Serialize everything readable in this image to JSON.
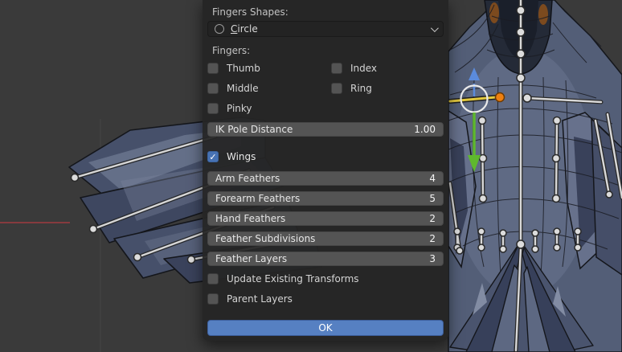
{
  "viewport": {
    "description": "Blender 3D viewport showing a rigged bird model with wing feathers and armature bones",
    "bg_color": "#3a3a3a",
    "axis_x_color": "#a03b40",
    "gizmo": {
      "circle_color": "#e8e8e8",
      "arrow_up_color": "#5b8bdc",
      "arrow_down_color": "#5fb82e",
      "selected_bone_color": "#e3c93f",
      "bone_tip_color": "#ee8011"
    }
  },
  "glyphs": {
    "check": "✓"
  },
  "colors": {
    "checkbox_checked": "#4772b3",
    "ok_button": "#5680c2",
    "field_bg": "#545454",
    "panel_bg": "#252525"
  },
  "panel": {
    "shape_section_label": "Fingers Shapes:",
    "shape_dropdown": {
      "value": "Circle",
      "icon": "circle-outline-icon"
    },
    "fingers_section_label": "Fingers:",
    "fingers": [
      {
        "label": "Thumb",
        "checked": false
      },
      {
        "label": "Index",
        "checked": false
      },
      {
        "label": "Middle",
        "checked": false
      },
      {
        "label": "Ring",
        "checked": false
      },
      {
        "label": "Pinky",
        "checked": false
      }
    ],
    "ik_pole_distance": {
      "label": "IK Pole Distance",
      "value": "1.00"
    },
    "wings": {
      "label": "Wings",
      "checked": true
    },
    "fields": [
      {
        "label": "Arm Feathers",
        "value": "4"
      },
      {
        "label": "Forearm Feathers",
        "value": "5"
      },
      {
        "label": "Hand Feathers",
        "value": "2"
      },
      {
        "label": "Feather Subdivisions",
        "value": "2"
      },
      {
        "label": "Feather Layers",
        "value": "3"
      }
    ],
    "options": [
      {
        "label": "Update Existing Transforms",
        "checked": false
      },
      {
        "label": "Parent Layers",
        "checked": false
      }
    ],
    "ok_button": {
      "label": "OK"
    }
  }
}
